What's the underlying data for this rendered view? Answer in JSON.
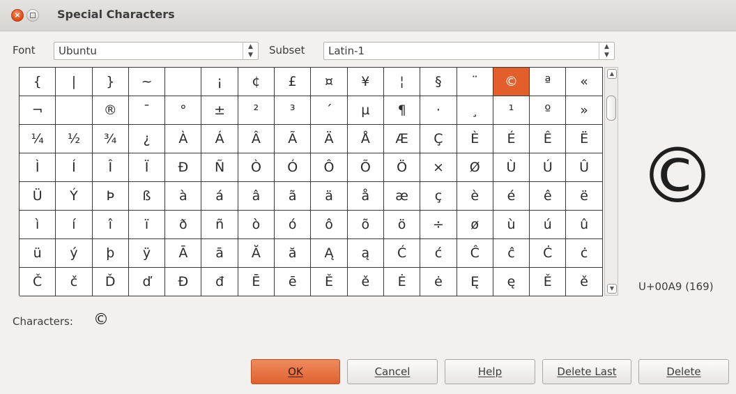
{
  "window": {
    "title": "Special Characters"
  },
  "toolbar": {
    "font_label": "Font",
    "font_value": "Ubuntu",
    "subset_label": "Subset",
    "subset_value": "Latin-1"
  },
  "grid": {
    "rows": [
      [
        "{",
        "|",
        "}",
        "~",
        " ",
        "¡",
        "¢",
        "£",
        "¤",
        "¥",
        "¦",
        "§",
        "¨",
        "©",
        "ª",
        "«"
      ],
      [
        "¬",
        "",
        "®",
        "¯",
        "°",
        "±",
        "²",
        "³",
        "´",
        "µ",
        "¶",
        "·",
        "¸",
        "¹",
        "º",
        "»"
      ],
      [
        "¼",
        "½",
        "¾",
        "¿",
        "À",
        "Á",
        "Â",
        "Ã",
        "Ä",
        "Å",
        "Æ",
        "Ç",
        "È",
        "É",
        "Ê",
        "Ë"
      ],
      [
        "Ì",
        "Í",
        "Î",
        "Ï",
        "Ð",
        "Ñ",
        "Ò",
        "Ó",
        "Ô",
        "Õ",
        "Ö",
        "×",
        "Ø",
        "Ù",
        "Ú",
        "Û"
      ],
      [
        "Ü",
        "Ý",
        "Þ",
        "ß",
        "à",
        "á",
        "â",
        "ã",
        "ä",
        "å",
        "æ",
        "ç",
        "è",
        "é",
        "ê",
        "ë"
      ],
      [
        "ì",
        "í",
        "î",
        "ï",
        "ð",
        "ñ",
        "ò",
        "ó",
        "ô",
        "õ",
        "ö",
        "÷",
        "ø",
        "ù",
        "ú",
        "û"
      ],
      [
        "ü",
        "ý",
        "þ",
        "ÿ",
        "Ā",
        "ā",
        "Ă",
        "ă",
        "Ą",
        "ą",
        "Ć",
        "ć",
        "Ĉ",
        "ĉ",
        "Ċ",
        "ċ"
      ],
      [
        "Č",
        "č",
        "Ď",
        "ď",
        "Đ",
        "đ",
        "Ē",
        "ē",
        "Ě",
        "ě",
        "Ė",
        "ė",
        "Ę",
        "ę",
        "Ě",
        "ě"
      ]
    ],
    "selected_row": 0,
    "selected_col": 13
  },
  "preview": {
    "glyph": "©",
    "code": "U+00A9 (169)"
  },
  "characters": {
    "label": "Characters:",
    "value": "©"
  },
  "buttons": {
    "ok": "OK",
    "cancel": "Cancel",
    "help": "Help",
    "delete_last": "Delete Last",
    "delete": "Delete"
  },
  "colors": {
    "accent": "#e25f2c",
    "close_button": "#dd4814"
  }
}
